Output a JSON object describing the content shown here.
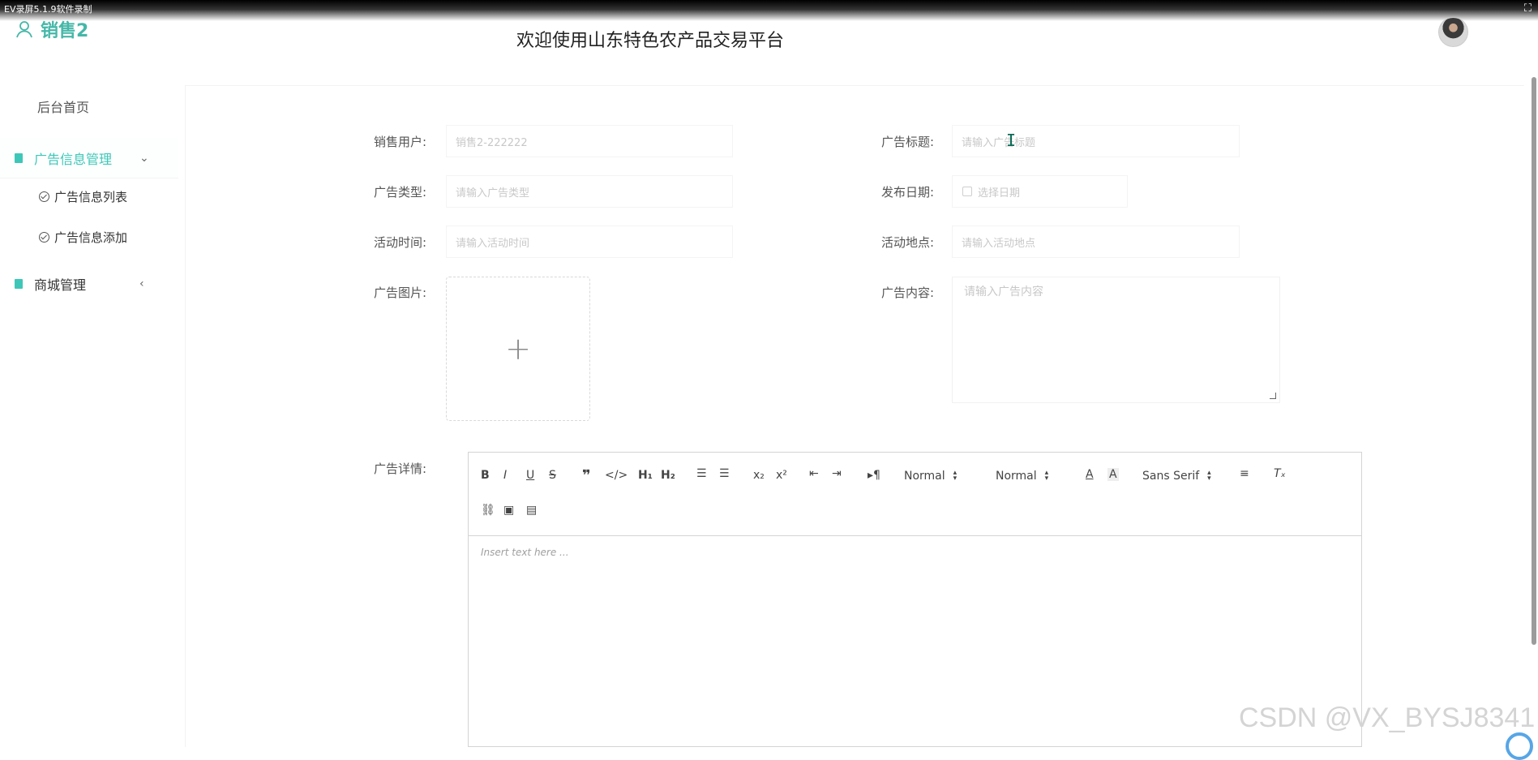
{
  "recording": {
    "label": "EV录屏5.1.9软件录制"
  },
  "header": {
    "brand": "销售2",
    "title": "欢迎使用山东特色农产品交易平台"
  },
  "sidebar": {
    "home": "后台首页",
    "ad_menu": "广告信息管理",
    "ad_list": "广告信息列表",
    "ad_add": "广告信息添加",
    "shop_menu": "商城管理"
  },
  "form": {
    "seller_label": "销售用户:",
    "seller_value": "销售2-222222",
    "title_label": "广告标题:",
    "title_placeholder": "请输入广告标题",
    "type_label": "广告类型:",
    "type_placeholder": "请输入广告类型",
    "date_label": "发布日期:",
    "date_placeholder": "选择日期",
    "time_label": "活动时间:",
    "time_placeholder": "请输入活动时间",
    "place_label": "活动地点:",
    "place_placeholder": "请输入活动地点",
    "image_label": "广告图片:",
    "content_label": "广告内容:",
    "content_placeholder": "请输入广告内容",
    "detail_label": "广告详情:"
  },
  "editor": {
    "header_select": "Normal",
    "size_select": "Normal",
    "font_select": "Sans Serif",
    "placeholder": "Insert text here ..."
  },
  "watermark": "CSDN @VX_BYSJ8341"
}
